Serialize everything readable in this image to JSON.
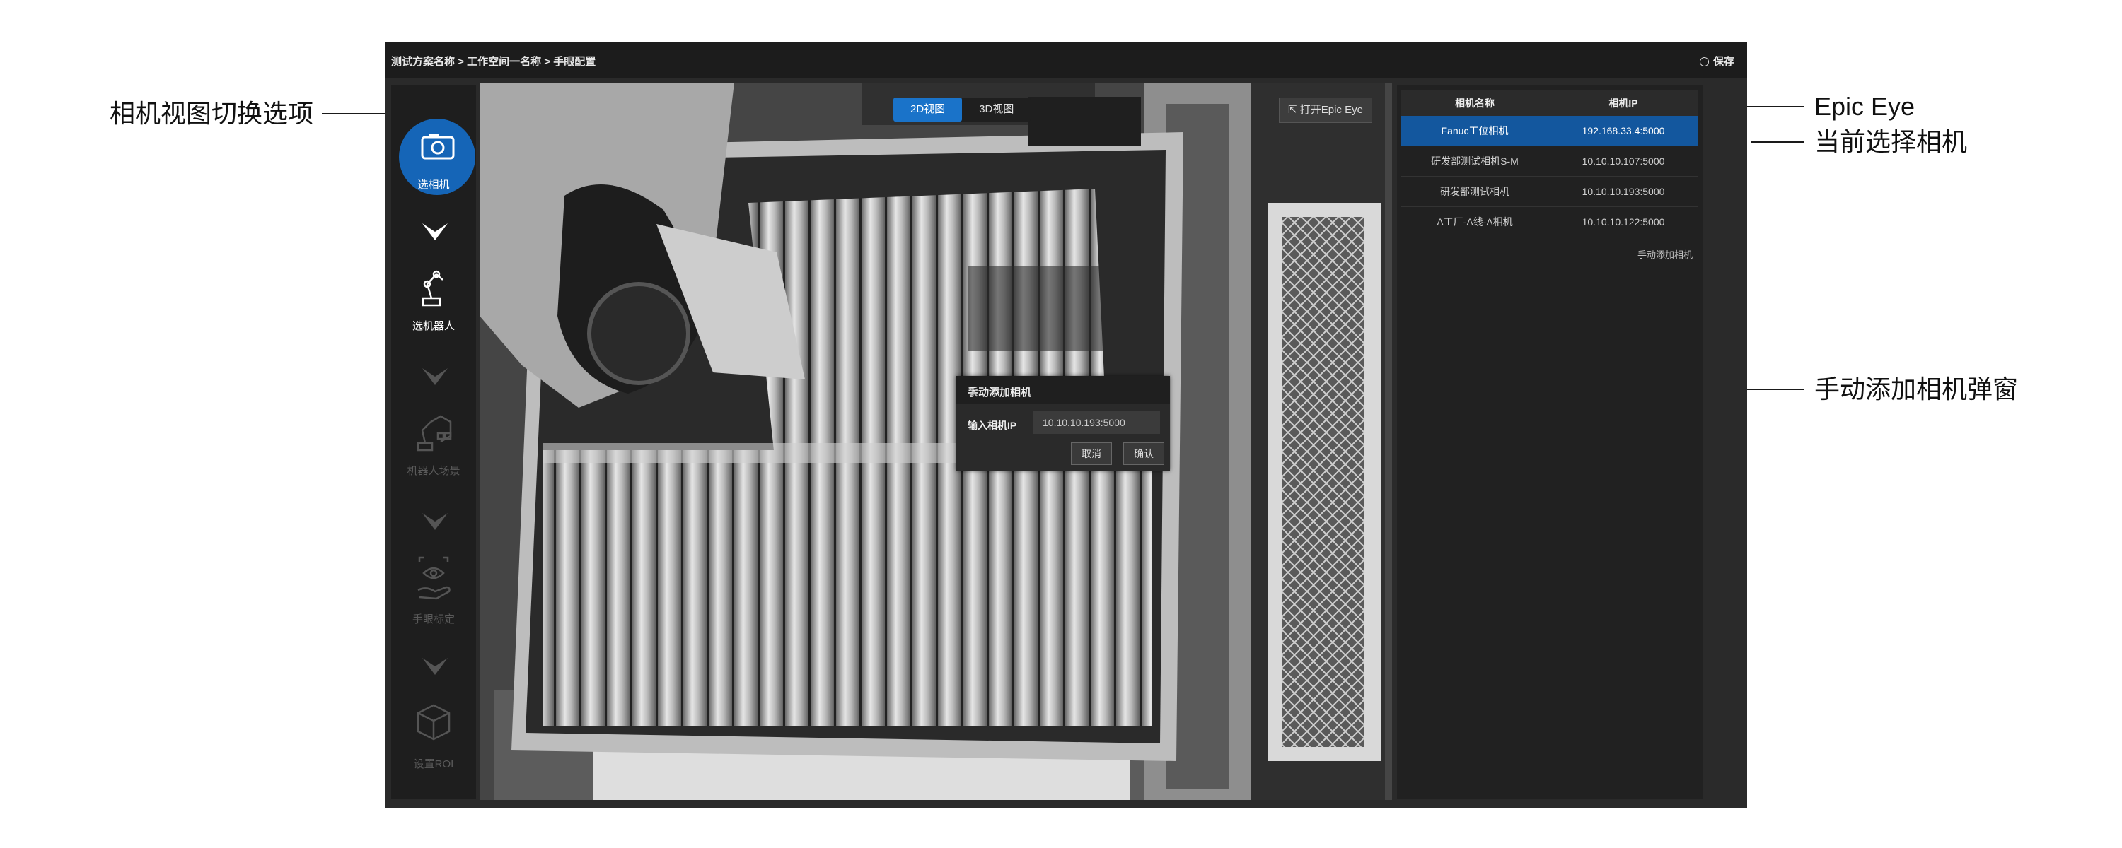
{
  "annotations": {
    "view_toggle": "相机视图切换选项",
    "epic_eye": "Epic Eye",
    "current_camera": "当前选择相机",
    "manual_dialog": "手动添加相机弹窗"
  },
  "header": {
    "breadcrumb": "测试方案名称 > 工作空间一名称 > 手眼配置",
    "save_label": "保存"
  },
  "sidebar": {
    "steps": [
      {
        "label": "选相机",
        "icon": "camera-icon",
        "state": "active"
      },
      {
        "label": "选机器人",
        "icon": "robot-arm-icon",
        "state": "done"
      },
      {
        "label": "机器人场景",
        "icon": "robot-scene-icon",
        "state": "disabled"
      },
      {
        "label": "手眼标定",
        "icon": "hand-eye-icon",
        "state": "disabled"
      },
      {
        "label": "设置ROI",
        "icon": "cube-icon",
        "state": "disabled"
      }
    ]
  },
  "viewport": {
    "view_tabs": [
      "2D视图",
      "3D视图"
    ],
    "active_tab": "2D视图",
    "epic_button": "打开Epic Eye"
  },
  "dialog": {
    "title": "手动添加相机",
    "ip_label": "输入相机IP",
    "ip_value": "10.10.10.193:5000",
    "cancel_label": "取消",
    "confirm_label": "确认"
  },
  "camera_panel": {
    "columns": [
      "相机名称",
      "相机IP"
    ],
    "rows": [
      {
        "name": "Fanuc工位相机",
        "ip": "192.168.33.4:5000",
        "selected": true
      },
      {
        "name": "研发部测试相机S-M",
        "ip": "10.10.10.107:5000",
        "selected": false
      },
      {
        "name": "研发部测试相机",
        "ip": "10.10.10.193:5000",
        "selected": false
      },
      {
        "name": "A工厂-A线-A相机",
        "ip": "10.10.10.122:5000",
        "selected": false
      }
    ],
    "manual_add_link": "手动添加相机"
  },
  "colors": {
    "accent": "#1a73c9",
    "selected_row": "#13579e",
    "panel_bg": "#212121"
  }
}
